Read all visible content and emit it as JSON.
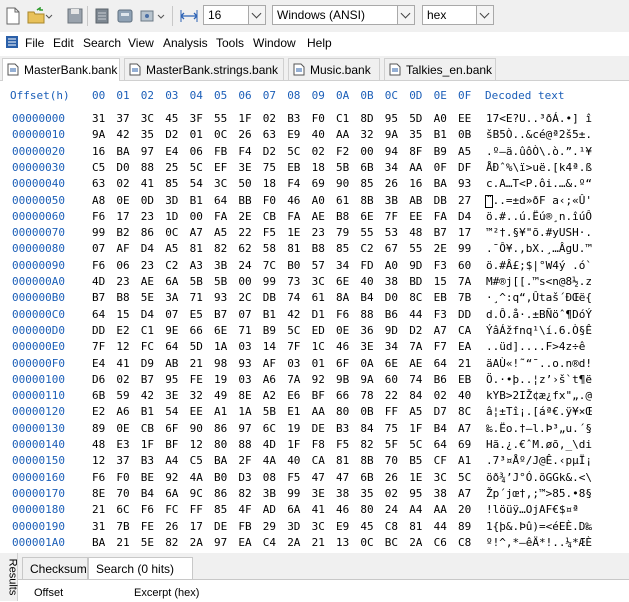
{
  "toolbar": {
    "width_value": "16",
    "encoding_value": "Windows (ANSI)",
    "mode_value": "hex"
  },
  "menu": [
    "File",
    "Edit",
    "Search",
    "View",
    "Analysis",
    "Tools",
    "Window",
    "Help"
  ],
  "tabs": [
    {
      "label": "MasterBank.bank",
      "active": true
    },
    {
      "label": "MasterBank.strings.bank",
      "active": false
    },
    {
      "label": "Music.bank",
      "active": false
    },
    {
      "label": "Talkies_en.bank",
      "active": false
    }
  ],
  "hex_header": {
    "offset_label": "Offset(h)",
    "columns": [
      "00",
      "01",
      "02",
      "03",
      "04",
      "05",
      "06",
      "07",
      "08",
      "09",
      "0A",
      "0B",
      "0C",
      "0D",
      "0E",
      "0F"
    ],
    "decoded_label": "Decoded text"
  },
  "rows": [
    {
      "offset": "00000000",
      "bytes": "31 37 3C 45 3F 55 1F 02 B3 F0 C1 8D 95 5D A0 EE",
      "text": "17<E?U..³ðÁ.•] î"
    },
    {
      "offset": "00000010",
      "bytes": "9A 42 35 D2 01 0C 26 63 E9 40 AA 32 9A 35 B1 0B",
      "text": "šB5Ò..&cé@ª2š5±."
    },
    {
      "offset": "00000020",
      "bytes": "16 BA 97 E4 06 FB F4 D2 5C 02 F2 00 94 8F B9 A5",
      "text": ".º—ä.ûôÒ\\.ò.”.¹¥"
    },
    {
      "offset": "00000030",
      "bytes": "C5 D0 88 25 5C EF 3E 75 EB 18 5B 6B 34 AA 0F DF",
      "text": "ÅÐˆ%\\ï>uë.[k4ª.ß"
    },
    {
      "offset": "00000040",
      "bytes": "63 02 41 85 54 3C 50 18 F4 69 90 85 26 16 BA 93",
      "text": "c.A…T<P.ôi.…&.º“"
    },
    {
      "offset": "00000050",
      "bytes": "A8 0E 0D 3D B1 64 BB F0 46 A0 61 8B 3B AB DB 27",
      "text": "¨..=±d»ðF a‹;«Û'"
    },
    {
      "offset": "00000060",
      "bytes": "F6 17 23 1D 00 FA 2E CB FA AE B8 6E 7F EE FA D4",
      "text": "ö.#..ú.Ëú®¸n.îúÔ"
    },
    {
      "offset": "00000070",
      "bytes": "99 B2 86 0C A7 A5 22 F5 1E 23 79 55 53 48 B7 17",
      "text": "™²†.§¥\"õ.#yUSH·."
    },
    {
      "offset": "00000080",
      "bytes": "07 AF D4 A5 81 82 62 58 81 B8 85 C2 67 55 2E 99",
      "text": ".¯Ô¥.‚bX.¸…ÂgU.™"
    },
    {
      "offset": "00000090",
      "bytes": "F6 06 23 C2 A3 3B 24 7C B0 57 34 FD A0 9D F3 60",
      "text": "ö.#Â£;$|°W4ý .ó`"
    },
    {
      "offset": "000000A0",
      "bytes": "4D 23 AE 6A 5B 5B 00 99 73 3C 6E 40 38 BD 15 7A",
      "text": "M#®j[[.™s<n@8½.z"
    },
    {
      "offset": "000000B0",
      "bytes": "B7 B8 5E 3A 71 93 2C DB 74 61 8A B4 D0 8C EB 7B",
      "text": "·¸^:q“,Ûtaš´ÐŒë{"
    },
    {
      "offset": "000000C0",
      "bytes": "64 15 D4 07 E5 B7 07 B1 42 D1 F6 88 B6 44 F3 DD",
      "text": "d.Ô.å·.±BÑöˆ¶DóÝ"
    },
    {
      "offset": "000000D0",
      "bytes": "DD E2 C1 9E 66 6E 71 B9 5C ED 0E 36 9D D2 A7 CA",
      "text": "ÝâÁžfnq¹\\í.6.Ò§Ê"
    },
    {
      "offset": "000000E0",
      "bytes": "7F 12 FC 64 5D 1A 03 14 7F 1C 46 3E 34 7A F7 EA",
      "text": "..üd]....F>4z÷ê"
    },
    {
      "offset": "000000F0",
      "bytes": "E4 41 D9 AB 21 98 93 AF 03 01 6F 0A 6E AE 64 21",
      "text": "äAÙ«!˜“¯..o.n®d!"
    },
    {
      "offset": "00000100",
      "bytes": "D6 02 B7 95 FE 19 03 A6 7A 92 9B 9A 60 74 B6 EB",
      "text": "Ö.·•þ..¦z’›š`t¶ë"
    },
    {
      "offset": "00000110",
      "bytes": "6B 59 42 3E 32 49 8E A2 E6 BF 66 78 22 84 02 40",
      "text": "kYB>2IŽ¢æ¿fx\"„.@"
    },
    {
      "offset": "00000120",
      "bytes": "E2 A6 B1 54 EE A1 1A 5B E1 AA 80 0B FF A5 D7 8C",
      "text": "â¦±Tî¡.[áª€.ÿ¥×Œ"
    },
    {
      "offset": "00000130",
      "bytes": "89 0E CB 6F 90 86 97 6C 19 DE B3 84 75 1F B4 A7",
      "text": "‰.Ëo.†—l.Þ³„u.´§"
    },
    {
      "offset": "00000140",
      "bytes": "48 E3 1F BF 12 80 88 4D 1F F8 F5 82 5F 5C 64 69",
      "text": "Hã.¿.€ˆM.øõ‚_\\di"
    },
    {
      "offset": "00000150",
      "bytes": "12 37 B3 A4 C5 BA 2F 4A 40 CA 81 8B 70 B5 CF A1",
      "text": ".7³¤Åº/J@Ê.‹pµÏ¡"
    },
    {
      "offset": "00000160",
      "bytes": "F6 F0 BE 92 4A B0 D3 08 F5 47 47 6B 26 1E 3C 5C",
      "text": "öð¾’J°Ó.õGGk&.<\\"
    },
    {
      "offset": "00000170",
      "bytes": "8E 70 B4 6A 9C 86 82 3B 99 3E 38 35 02 95 38 A7",
      "text": "Žp´jœ†‚;™>85.•8§"
    },
    {
      "offset": "00000180",
      "bytes": "21 6C F6 FC FF 85 4F AD 6A 41 46 80 24 A4 AA 20",
      "text": "!löüÿ…O­jAF€$¤ª "
    },
    {
      "offset": "00000190",
      "bytes": "31 7B FE 26 17 DE FB 29 3D 3C E9 45 C8 81 44 89",
      "text": "1{þ&.Þû)=<éEÈ.D‰"
    },
    {
      "offset": "000001A0",
      "bytes": "BA 21 5E 82 2A 97 EA C4 2A 21 13 0C BC 2A C6 C8",
      "text": "º!^‚*—êÄ*!..¼*ÆÈ"
    },
    {
      "offset": "000001B0",
      "bytes": "72 FF 60 04 70 5D 0B 94 6A 6D 2A DA 74 BC C3 BD",
      "text": "rÿ`.p].”jm*Út¼Ã½"
    }
  ],
  "bottom_panel": {
    "side_label": "Results",
    "tabs": [
      {
        "label": "Checksum",
        "active": false
      },
      {
        "label": "Search (0 hits)",
        "active": true
      }
    ],
    "columns": [
      "Offset",
      "Excerpt (hex)"
    ]
  },
  "colors": {
    "offset_blue": "#1c5fb8",
    "toolbar_bg": "#f0f0f0"
  }
}
